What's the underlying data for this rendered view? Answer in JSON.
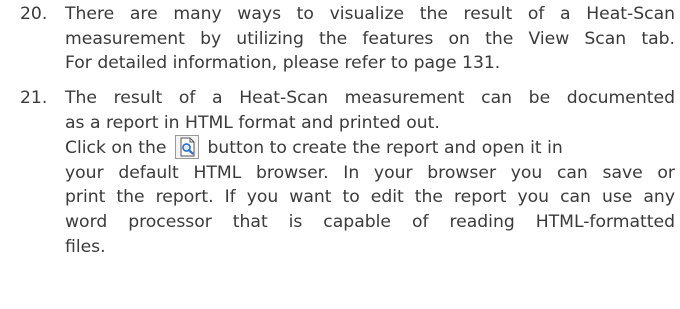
{
  "items": [
    {
      "number": "20.",
      "lines": [
        "There are many ways to visualize the result of a Heat-Scan",
        "measurement by utilizing the features on the View Scan tab.",
        "For detailed information, please refer to page 131."
      ]
    },
    {
      "number": "21.",
      "lines_a": [
        "The result of a Heat-Scan measurement can be documented",
        "as a report in HTML format and printed out."
      ],
      "click_pre": "Click on the",
      "click_post": "button to create the report and open it in",
      "lines_b": [
        "your default HTML browser. In your browser you can save or",
        "print the report. If you want to edit the report you can use any",
        "word processor that is capable of reading HTML-formatted",
        "files."
      ]
    }
  ],
  "icons": {
    "report_button": "report-preview-icon"
  },
  "colors": {
    "text": "#3a3a3a",
    "icon_accent": "#2a6fc9"
  }
}
